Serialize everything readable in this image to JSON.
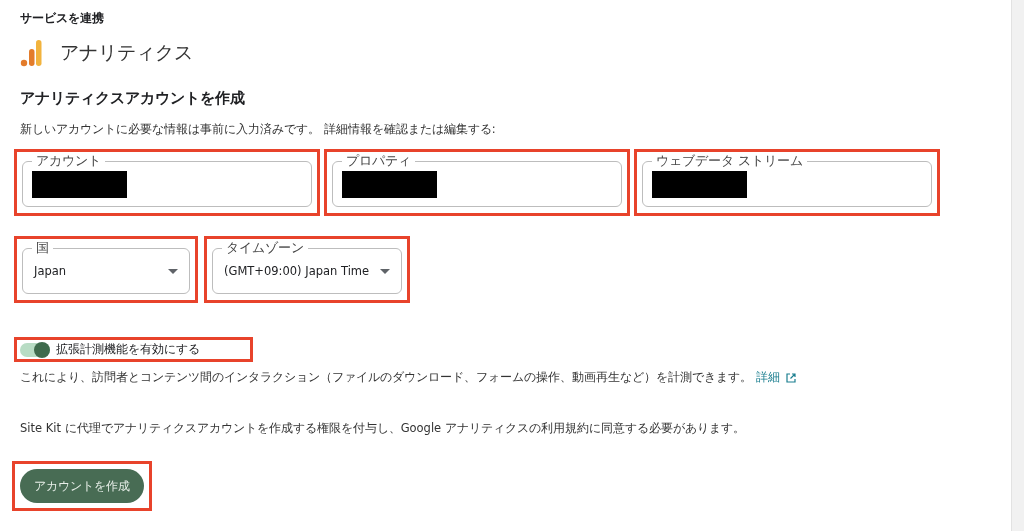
{
  "breadcrumb": "サービスを連携",
  "service": {
    "name": "アナリティクス"
  },
  "heading": "アナリティクスアカウントを作成",
  "intro": "新しいアカウントに必要な情報は事前に入力済みです。 詳細情報を確認または編集する:",
  "text_fields": [
    {
      "label": "アカウント",
      "redacted": true,
      "highlighted": true
    },
    {
      "label": "プロパティ",
      "redacted": true,
      "highlighted": true
    },
    {
      "label": "ウェブデータ ストリーム",
      "redacted": true,
      "highlighted": true
    }
  ],
  "selects": [
    {
      "label": "国",
      "value": "Japan",
      "highlighted": true
    },
    {
      "label": "タイムゾーン",
      "value": "(GMT+09:00) Japan Time",
      "highlighted": true
    }
  ],
  "toggle": {
    "label": "拡張計測機能を有効にする",
    "on": true,
    "highlighted": true
  },
  "toggle_help": "これにより、訪問者とコンテンツ間のインタラクション（ファイルのダウンロード、フォームの操作、動画再生など）を計測できます。",
  "help_link": "詳細",
  "notice": "Site Kit に代理でアナリティクスアカウントを作成する権限を付与し、Google アナリティクスの利用規約に同意する必要があります。",
  "submit": {
    "label": "アカウントを作成",
    "highlighted": true
  }
}
